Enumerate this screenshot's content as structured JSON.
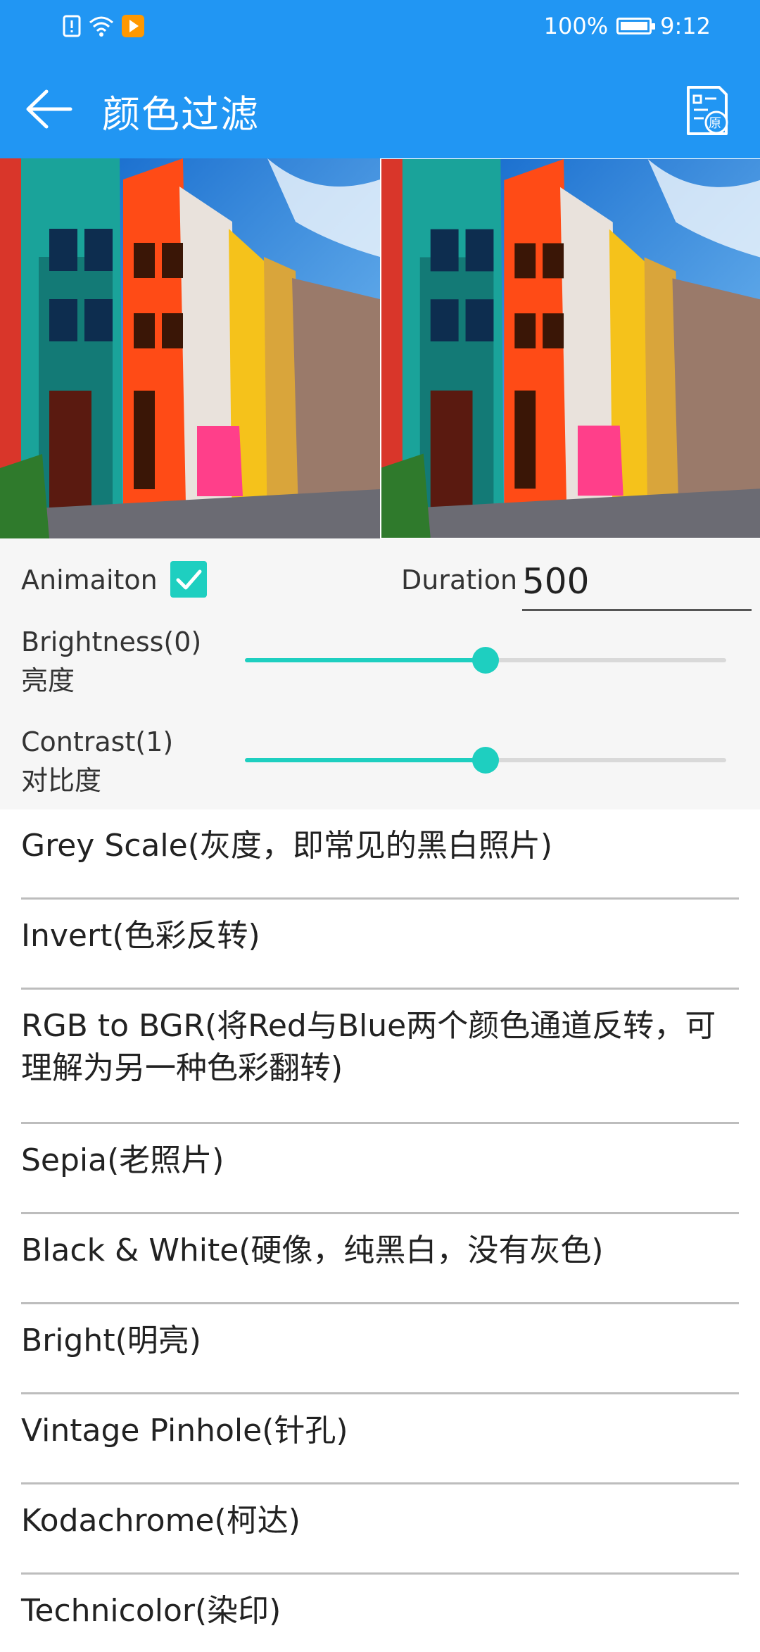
{
  "status_bar": {
    "battery": "100%",
    "time": "9:12",
    "battery_level": 1.0,
    "left_icons": [
      "alert-icon",
      "wifi-icon",
      "play-store-icon"
    ]
  },
  "app_bar": {
    "title": "颜色过滤",
    "back_icon": "arrow-left-icon",
    "action_icon": "original-compare-icon",
    "action_badge": "原"
  },
  "controls": {
    "animation_label": "Animaiton",
    "animation_checked": true,
    "duration_label": "Duration",
    "duration_value": "500",
    "brightness_label": "Brightness(0)",
    "brightness_cn": "亮度",
    "brightness_level": 0.5,
    "contrast_label": "Contrast(1)",
    "contrast_cn": "对比度",
    "contrast_level": 0.5
  },
  "filters": [
    "Grey Scale(灰度，即常见的黑白照片)",
    "Invert(色彩反转)",
    "RGB to BGR(将Red与Blue两个颜色通道反转，可理解为另一种色彩翻转)",
    "Sepia(老照片)",
    "Black & White(硬像，纯黑白，没有灰色)",
    "Bright(明亮)",
    "Vintage Pinhole(针孔)",
    "Kodachrome(柯达)",
    "Technicolor(染印)"
  ],
  "colors": {
    "primary": "#2196F3",
    "accent": "#1ecfc0"
  }
}
